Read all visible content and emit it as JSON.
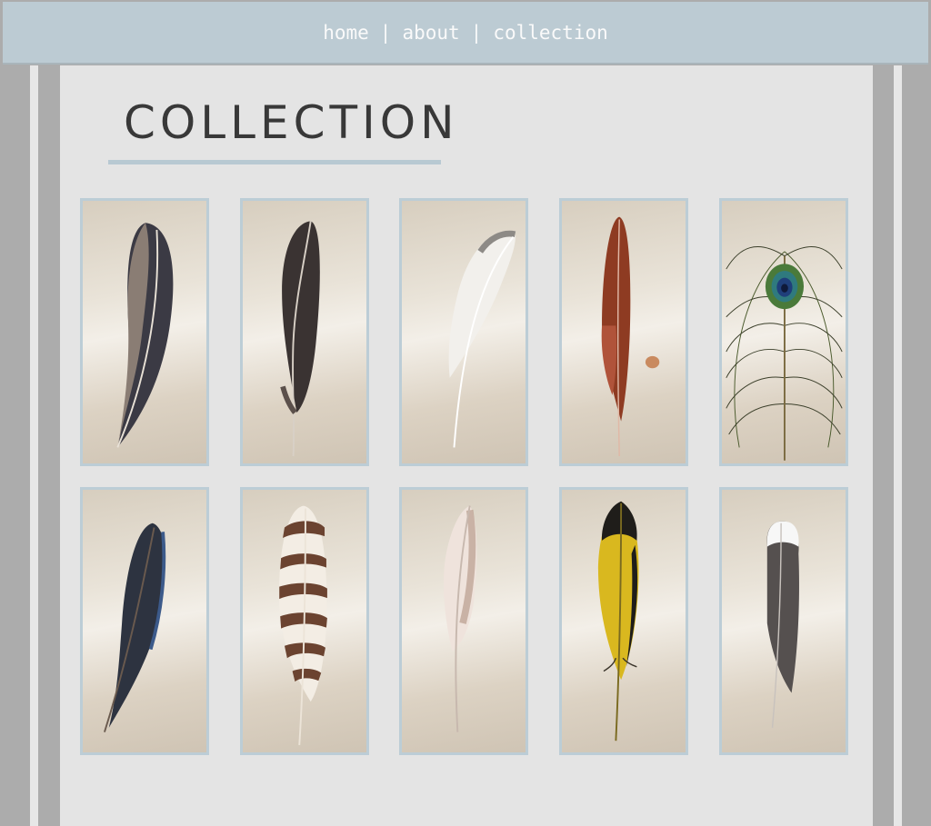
{
  "nav": {
    "items": [
      {
        "label": "home"
      },
      {
        "label": "about"
      },
      {
        "label": "collection"
      }
    ],
    "separator": "|"
  },
  "page": {
    "title": "COLLECTION"
  },
  "colors": {
    "nav_bar": "#bccbd3",
    "background": "#acacac",
    "panel": "#e4e4e4",
    "accent": "#b8c9d2",
    "title_text": "#383838"
  },
  "gallery": {
    "items": [
      {
        "icon": "dark-brown-feather-image",
        "colors": [
          "#3b3a44",
          "#8a7d74"
        ]
      },
      {
        "icon": "black-feather-image",
        "colors": [
          "#3a3332",
          "#5b504b"
        ]
      },
      {
        "icon": "white-gray-feather-image",
        "colors": [
          "#f2f0ec",
          "#8d8a86"
        ]
      },
      {
        "icon": "rust-red-feather-image",
        "colors": [
          "#8e3b22",
          "#b0533a"
        ]
      },
      {
        "icon": "peacock-feather-image",
        "colors": [
          "#2f7a7e",
          "#4a5a2c"
        ]
      },
      {
        "icon": "iridescent-blue-black-feather-image",
        "colors": [
          "#2d3340",
          "#6a5a4e"
        ]
      },
      {
        "icon": "barred-brown-feather-image",
        "colors": [
          "#6b4330",
          "#f3ede4"
        ]
      },
      {
        "icon": "pale-pink-white-feather-image",
        "colors": [
          "#efe3dc",
          "#b99c8d"
        ]
      },
      {
        "icon": "yellow-black-feather-image",
        "colors": [
          "#d9b81f",
          "#1f1d1a"
        ]
      },
      {
        "icon": "gray-white-tipped-feather-image",
        "colors": [
          "#55504f",
          "#f7f7f7"
        ]
      }
    ]
  }
}
